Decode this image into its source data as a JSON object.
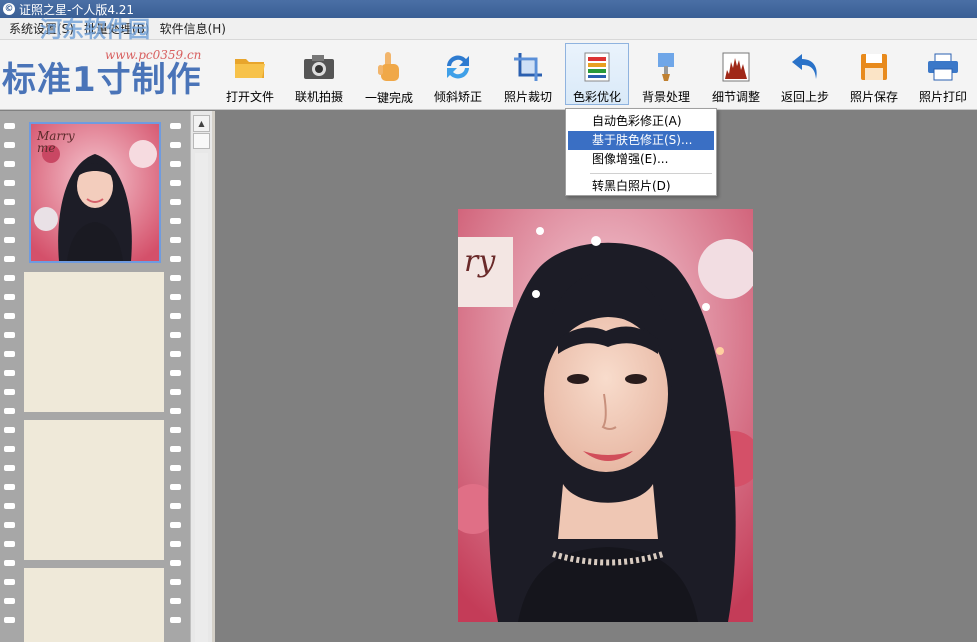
{
  "window": {
    "title": "证照之星-个人版4.21"
  },
  "menu": [
    {
      "label": "系统设置(S)"
    },
    {
      "label": "批量处理(B)"
    },
    {
      "label": "软件信息(H)"
    }
  ],
  "branding": {
    "logo_text": "标准1寸制作",
    "watermark_text": "河东软件园",
    "watermark_url": "www.pc0359.cn"
  },
  "toolbar": [
    {
      "label": "打开文件",
      "icon": "folder-icon"
    },
    {
      "label": "联机拍摄",
      "icon": "camera-icon"
    },
    {
      "label": "一键完成",
      "icon": "hand-pointer-icon"
    },
    {
      "label": "倾斜矫正",
      "icon": "rotate-arrows-icon"
    },
    {
      "label": "照片裁切",
      "icon": "crop-icon"
    },
    {
      "label": "色彩优化",
      "icon": "color-bars-icon"
    },
    {
      "label": "背景处理",
      "icon": "brush-icon"
    },
    {
      "label": "细节调整",
      "icon": "histogram-icon"
    },
    {
      "label": "返回上步",
      "icon": "undo-arrow-icon"
    },
    {
      "label": "照片保存",
      "icon": "floppy-disk-icon"
    },
    {
      "label": "照片打印",
      "icon": "printer-icon"
    }
  ],
  "color_menu": {
    "items": [
      {
        "label": "自动色彩修正(A)"
      },
      {
        "label": "基于肤色修正(S)..."
      },
      {
        "label": "图像增强(E)..."
      },
      {
        "label": "转黑白照片(D)"
      }
    ],
    "selected_index": 1
  },
  "thumbnail_text": "Marry me",
  "photo_text": "ry",
  "colors": {
    "accent": "#3a6fc4",
    "logo": "#4a74b8",
    "canvas": "#808080",
    "film": "#a7a7a7"
  }
}
